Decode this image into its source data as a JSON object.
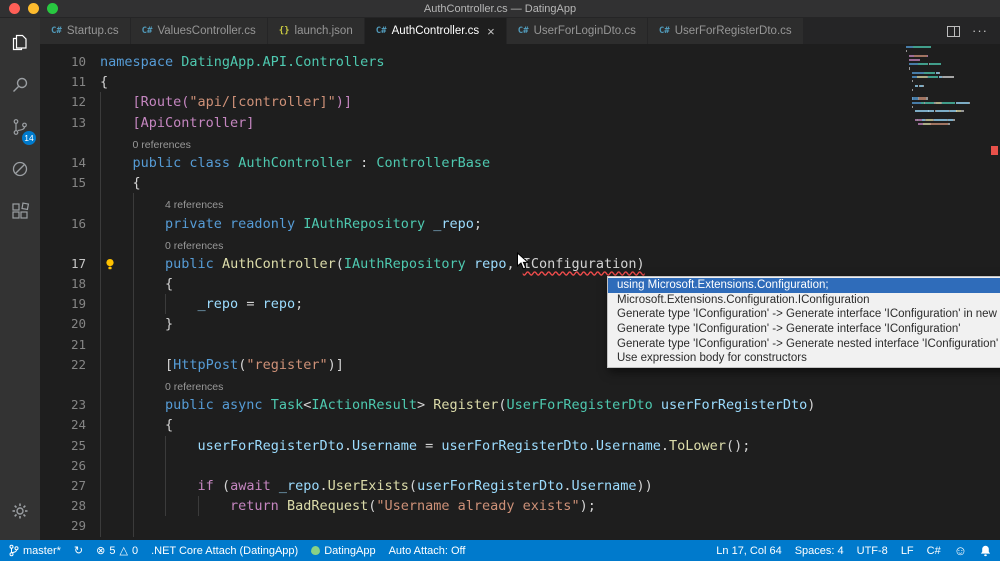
{
  "window": {
    "title": "AuthController.cs — DatingApp"
  },
  "colors": {
    "status_bar_bg": "#007ACC",
    "badge_bg": "#007ACC",
    "popup_selection_bg": "#2F6CBA",
    "error_squiggle": "#F14C4C",
    "overview_marker": "#E8514A"
  },
  "icons": {
    "sync": "↻",
    "error": "⊗",
    "warning": "△",
    "smiley": "☺",
    "more_actions": "···",
    "close_tab": "×"
  },
  "activity_bar": {
    "scm_badge": "14"
  },
  "tab_bar": {
    "tabs": [
      {
        "label": "Startup.cs",
        "icon": "C#",
        "icon_color": "#519aba",
        "active": false
      },
      {
        "label": "ValuesController.cs",
        "icon": "C#",
        "icon_color": "#519aba",
        "active": false
      },
      {
        "label": "launch.json",
        "icon": "{}",
        "icon_color": "#cbcb41",
        "active": false
      },
      {
        "label": "AuthController.cs",
        "icon": "C#",
        "icon_color": "#519aba",
        "active": true
      },
      {
        "label": "UserForLoginDto.cs",
        "icon": "C#",
        "icon_color": "#519aba",
        "active": false
      },
      {
        "label": "UserForRegisterDto.cs",
        "icon": "C#",
        "icon_color": "#519aba",
        "active": false
      }
    ]
  },
  "editor": {
    "current_line": "17",
    "rows": [
      {
        "n": "10",
        "g": 0,
        "t": [
          [
            "kw",
            "namespace "
          ],
          [
            "type",
            "DatingApp.API.Controllers"
          ]
        ]
      },
      {
        "n": "11",
        "g": 0,
        "t": [
          [
            "pl",
            "{"
          ]
        ]
      },
      {
        "n": "12",
        "g": 1,
        "t": [
          [
            "pl",
            "    "
          ],
          [
            "attr",
            "[Route("
          ],
          [
            "str",
            "\"api/[controller]\""
          ],
          [
            "attr",
            ")]"
          ]
        ]
      },
      {
        "n": "13",
        "g": 1,
        "t": [
          [
            "pl",
            "    "
          ],
          [
            "attr",
            "[ApiController]"
          ]
        ]
      },
      {
        "lens": "0 references",
        "ind": 4,
        "g": 1
      },
      {
        "n": "14",
        "g": 1,
        "t": [
          [
            "pl",
            "    "
          ],
          [
            "kw",
            "public class "
          ],
          [
            "type",
            "AuthController"
          ],
          [
            "pl",
            " : "
          ],
          [
            "type",
            "ControllerBase"
          ]
        ]
      },
      {
        "n": "15",
        "g": 1,
        "t": [
          [
            "pl",
            "    {"
          ]
        ]
      },
      {
        "lens": "4 references",
        "ind": 8,
        "g": 2
      },
      {
        "n": "16",
        "g": 2,
        "t": [
          [
            "pl",
            "        "
          ],
          [
            "kw",
            "private readonly "
          ],
          [
            "type",
            "IAuthRepository"
          ],
          [
            "pl",
            " "
          ],
          [
            "var",
            "_repo"
          ],
          [
            "pl",
            ";"
          ]
        ]
      },
      {
        "lens": "0 references",
        "ind": 8,
        "g": 2
      },
      {
        "n": "17",
        "g": 2,
        "bulb": true,
        "cur": true,
        "t": [
          [
            "pl",
            "        "
          ],
          [
            "kw",
            "public "
          ],
          [
            "meth",
            "AuthController"
          ],
          [
            "pl",
            "("
          ],
          [
            "type",
            "IAuthRepository"
          ],
          [
            "pl",
            " "
          ],
          [
            "var",
            "repo"
          ],
          [
            "pl",
            ", "
          ],
          [
            "err",
            "IConfiguration)"
          ]
        ]
      },
      {
        "n": "18",
        "g": 2,
        "t": [
          [
            "pl",
            "        {"
          ]
        ]
      },
      {
        "n": "19",
        "g": 3,
        "t": [
          [
            "pl",
            "            "
          ],
          [
            "var",
            "_repo"
          ],
          [
            "pl",
            " = "
          ],
          [
            "var",
            "repo"
          ],
          [
            "pl",
            ";"
          ]
        ]
      },
      {
        "n": "20",
        "g": 2,
        "t": [
          [
            "pl",
            "        }"
          ]
        ]
      },
      {
        "n": "21",
        "g": 2,
        "t": []
      },
      {
        "n": "22",
        "g": 2,
        "t": [
          [
            "pl",
            "        ["
          ],
          [
            "kw",
            "HttpPost"
          ],
          [
            "pl",
            "("
          ],
          [
            "str",
            "\"register\""
          ],
          [
            "pl",
            ")]"
          ]
        ]
      },
      {
        "lens": "0 references",
        "ind": 8,
        "g": 2
      },
      {
        "n": "23",
        "g": 2,
        "t": [
          [
            "pl",
            "        "
          ],
          [
            "kw",
            "public async "
          ],
          [
            "type",
            "Task"
          ],
          [
            "pl",
            "<"
          ],
          [
            "type",
            "IActionResult"
          ],
          [
            "pl",
            "> "
          ],
          [
            "meth",
            "Register"
          ],
          [
            "pl",
            "("
          ],
          [
            "type",
            "UserForRegisterDto"
          ],
          [
            "pl",
            " "
          ],
          [
            "var",
            "userForRegisterDto"
          ],
          [
            "pl",
            ")"
          ]
        ]
      },
      {
        "n": "24",
        "g": 2,
        "t": [
          [
            "pl",
            "        {"
          ]
        ]
      },
      {
        "n": "25",
        "g": 3,
        "t": [
          [
            "pl",
            "            "
          ],
          [
            "var",
            "userForRegisterDto"
          ],
          [
            "pl",
            "."
          ],
          [
            "var",
            "Username"
          ],
          [
            "pl",
            " = "
          ],
          [
            "var",
            "userForRegisterDto"
          ],
          [
            "pl",
            "."
          ],
          [
            "var",
            "Username"
          ],
          [
            "pl",
            "."
          ],
          [
            "meth",
            "ToLower"
          ],
          [
            "pl",
            "();"
          ]
        ]
      },
      {
        "n": "26",
        "g": 3,
        "t": []
      },
      {
        "n": "27",
        "g": 3,
        "t": [
          [
            "pl",
            "            "
          ],
          [
            "ctrl",
            "if "
          ],
          [
            "pl",
            "("
          ],
          [
            "ctrl",
            "await "
          ],
          [
            "var",
            "_repo"
          ],
          [
            "pl",
            "."
          ],
          [
            "meth",
            "UserExists"
          ],
          [
            "pl",
            "("
          ],
          [
            "var",
            "userForRegisterDto"
          ],
          [
            "pl",
            "."
          ],
          [
            "var",
            "Username"
          ],
          [
            "pl",
            "))"
          ]
        ]
      },
      {
        "n": "28",
        "g": 4,
        "t": [
          [
            "pl",
            "                "
          ],
          [
            "ctrl",
            "return "
          ],
          [
            "meth",
            "BadRequest"
          ],
          [
            "pl",
            "("
          ],
          [
            "str",
            "\"Username already exists\""
          ],
          [
            "pl",
            ");"
          ]
        ]
      },
      {
        "n": "29",
        "g": 2,
        "t": []
      }
    ]
  },
  "quick_fix_menu": {
    "items": [
      {
        "label": "using Microsoft.Extensions.Configuration;",
        "selected": true
      },
      {
        "label": "Microsoft.Extensions.Configuration.IConfiguration",
        "selected": false
      },
      {
        "label": "Generate type 'IConfiguration' -> Generate interface 'IConfiguration' in new file",
        "selected": false
      },
      {
        "label": "Generate type 'IConfiguration' -> Generate interface 'IConfiguration'",
        "selected": false
      },
      {
        "label": "Generate type 'IConfiguration' -> Generate nested interface 'IConfiguration'",
        "selected": false
      },
      {
        "label": "Use expression body for constructors",
        "selected": false
      }
    ]
  },
  "status_bar": {
    "branch": "master*",
    "errors": "5",
    "warnings": "0",
    "debug_target": ".NET Core Attach (DatingApp)",
    "project": "DatingApp",
    "auto_attach": "Auto Attach: Off",
    "cursor_position": "Ln 17, Col 64",
    "indentation": "Spaces: 4",
    "encoding": "UTF-8",
    "eol": "LF",
    "language": "C#"
  }
}
